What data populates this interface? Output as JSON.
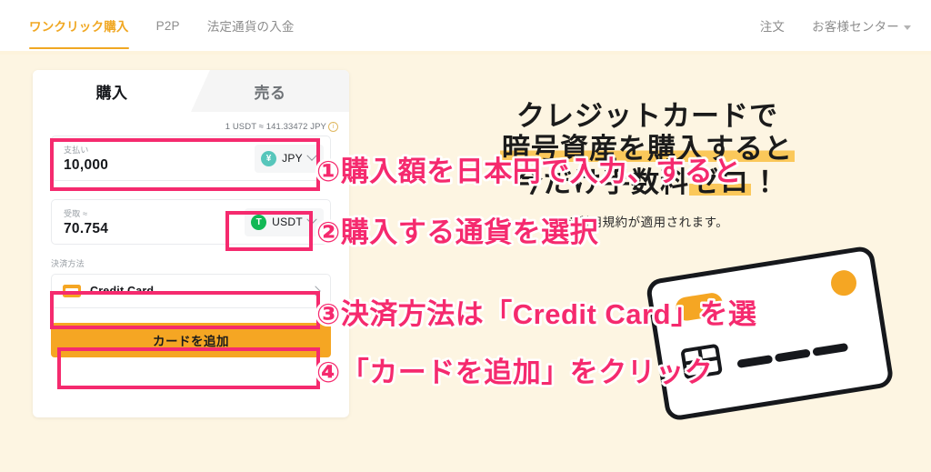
{
  "nav": {
    "left_items": [
      {
        "label": "ワンクリック購入",
        "active": true
      },
      {
        "label": "P2P",
        "active": false
      },
      {
        "label": "法定通貨の入金",
        "active": false
      }
    ],
    "right_items": [
      {
        "label": "注文",
        "caret": false
      },
      {
        "label": "お客様センター",
        "caret": true
      }
    ]
  },
  "widget": {
    "tabs": [
      {
        "label": "購入",
        "selected": true
      },
      {
        "label": "売る",
        "selected": false
      }
    ],
    "rate_text": "1 USDT ≈ 141.33472 JPY",
    "rate_info_icon": "info-icon",
    "pay_field": {
      "label": "支払い",
      "value": "10,000",
      "currency_code": "JPY",
      "currency_symbol": "¥",
      "currency_color": "#57c6bb",
      "chevron_icon": "chevron-down-icon"
    },
    "receive_field": {
      "label": "受取 ≈",
      "value": "70.754",
      "currency_code": "USDT",
      "currency_symbol": "T",
      "currency_color": "#12b855",
      "chevron_icon": "chevron-down-icon"
    },
    "payment_section_label": "決済方法",
    "payment_method": {
      "name": "Credit Card",
      "icon": "credit-card-icon",
      "chevron_icon": "chevron-right-icon"
    },
    "cta_label": "カードを追加"
  },
  "promo": {
    "line1": "クレジットカードで",
    "line2_plain": "暗号資産を購入すると",
    "line2_highlight": "",
    "line3_a": "今だけ手数料",
    "line3_zero": "ゼロ",
    "line3_b": "！",
    "note": "※利用規約が適用されます。"
  },
  "annotations": [
    {
      "id": 1,
      "text": "①購入額を日本円で入力、すると"
    },
    {
      "id": 2,
      "text": "②購入する通貨を選択"
    },
    {
      "id": 3,
      "text": "③決済方法は「Credit Card」を選"
    },
    {
      "id": 4,
      "text": "④「カードを追加」をクリック"
    }
  ],
  "colors": {
    "page_background": "#fdf5e2",
    "accent_orange": "#f5a623",
    "nav_active": "#f0a722",
    "highlight_pink": "#f52a6e",
    "card_white": "#ffffff"
  }
}
